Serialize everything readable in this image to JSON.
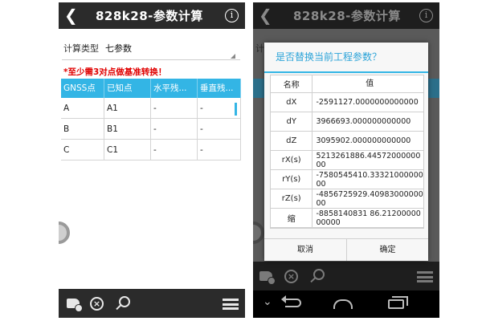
{
  "app_title": "828k28-参数计算",
  "left": {
    "calc_type_label": "计算类型",
    "calc_type_value": "七参数",
    "warning": "*至少需3对点做基准转换！",
    "table": {
      "headers": [
        "GNSS点",
        "已知点",
        "水平残...",
        "垂直残..."
      ],
      "rows": [
        [
          "A",
          "A1",
          "-",
          "-"
        ],
        [
          "B",
          "B1",
          "-",
          "-"
        ],
        [
          "C",
          "C1",
          "-",
          "-"
        ]
      ]
    }
  },
  "right": {
    "bg_calc_char": "计",
    "dialog": {
      "title": "是否替换当前工程参数？",
      "col_name": "名称",
      "col_value": "值",
      "rows": [
        {
          "name": "dX",
          "value": "-2591127.0000000000000"
        },
        {
          "name": "dY",
          "value": "3966693.000000000000"
        },
        {
          "name": "dZ",
          "value": "3095902.000000000000"
        },
        {
          "name": "rX(s)",
          "value": "5213261886.4457200000000"
        },
        {
          "name": "rY(s)",
          "value": "-7580545410.3332100000000"
        },
        {
          "name": "rZ(s)",
          "value": "-4856725929.4098300000000"
        },
        {
          "name": "缩",
          "value": "-8858140831 86.2120000000000"
        }
      ],
      "cancel": "取消",
      "ok": "确定"
    }
  },
  "colors": {
    "accent": "#33b5e5",
    "warning": "#e00000",
    "header_bg": "#2b2b2b"
  }
}
